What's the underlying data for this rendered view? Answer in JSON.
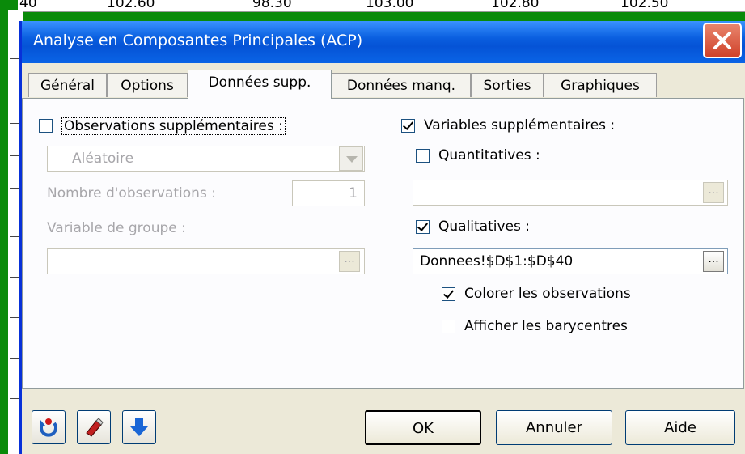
{
  "background_sheet": {
    "row_label": "40",
    "cells": [
      "102.60",
      "98.30",
      "103.00",
      "102.80",
      "102.50"
    ]
  },
  "dialog": {
    "title": "Analyse en Composantes Principales (ACP)",
    "tabs": [
      {
        "label": "Général",
        "active": false
      },
      {
        "label": "Options",
        "active": false
      },
      {
        "label": "Données supp.",
        "active": true
      },
      {
        "label": "Données manq.",
        "active": false
      },
      {
        "label": "Sorties",
        "active": false
      },
      {
        "label": "Graphiques",
        "active": false
      }
    ],
    "left": {
      "obs_supp_label": "Observations supplémentaires :",
      "obs_supp_checked": false,
      "method_value": "Aléatoire",
      "nb_obs_label": "Nombre d'observations :",
      "nb_obs_value": "1",
      "group_var_label": "Variable de groupe :",
      "group_var_value": ""
    },
    "right": {
      "var_supp_label": "Variables supplémentaires :",
      "var_supp_checked": true,
      "quant_label": "Quantitatives :",
      "quant_checked": false,
      "quant_value": "",
      "qual_label": "Qualitatives :",
      "qual_checked": true,
      "qual_value": "Donnees!$D$1:$D$40",
      "color_obs_label": "Colorer les observations",
      "color_obs_checked": true,
      "bary_label": "Afficher les barycentres",
      "bary_checked": false,
      "ellipsis": "..."
    },
    "buttons": {
      "ok": "OK",
      "cancel": "Annuler",
      "help": "Aide"
    },
    "icons": [
      "reset-icon",
      "eraser-icon",
      "down-arrow-icon",
      "close-icon"
    ],
    "colors": {
      "title_bar": "#0553d6",
      "close": "#d0422a",
      "face": "#ece9d8",
      "desktop": "#0a8a0a"
    }
  }
}
